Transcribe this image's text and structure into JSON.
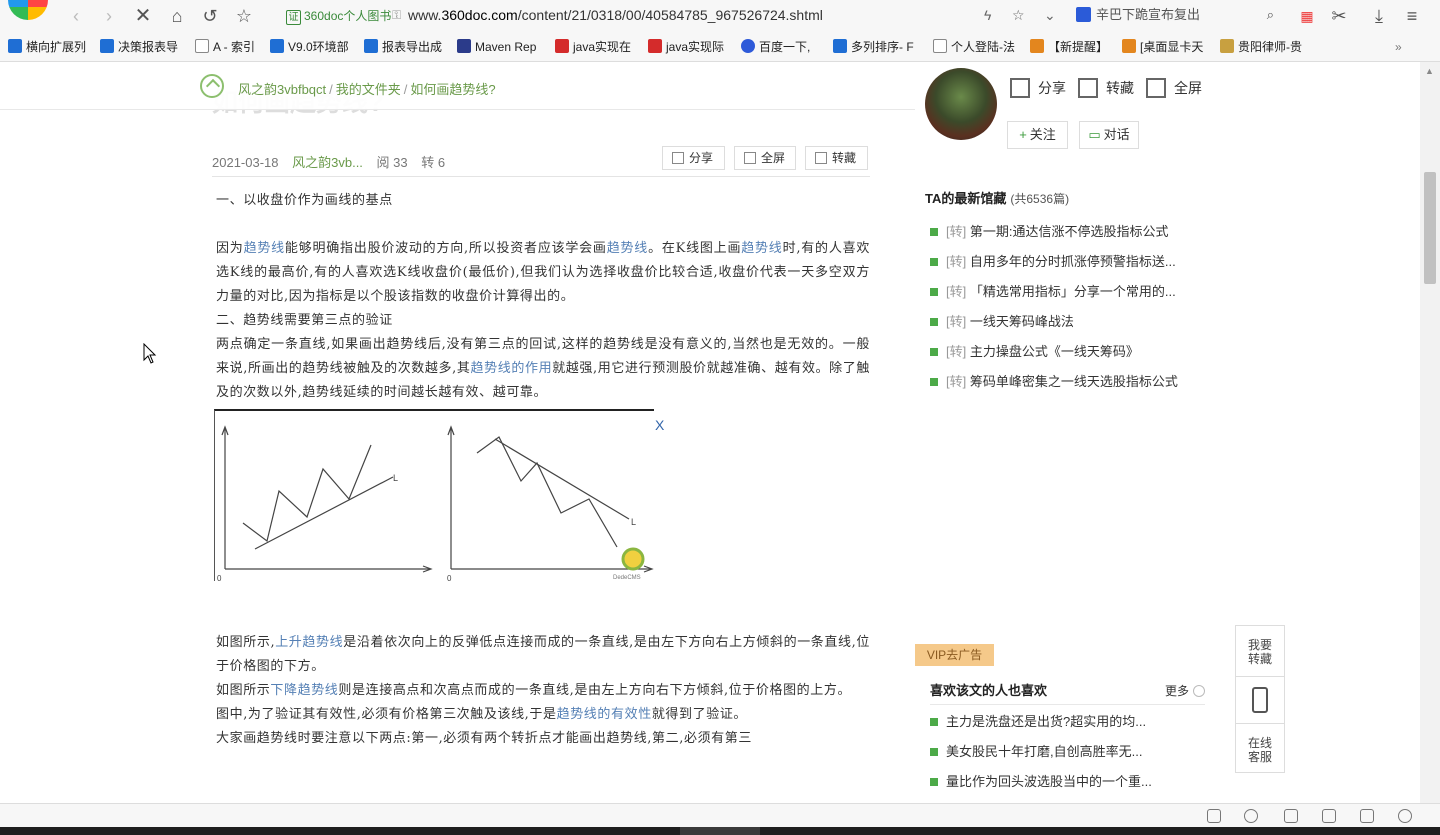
{
  "browser": {
    "site_tag": "360doc个人图书",
    "url_prefix": "www.",
    "url_domain": "360doc.com",
    "url_path": "/content/21/0318/00/40584785_967526724.shtml",
    "search_text": "辛巴下跪宣布复出"
  },
  "bookmarks": [
    {
      "label": "横向扩展列",
      "icon": "blue"
    },
    {
      "label": "决策报表导",
      "icon": "blue"
    },
    {
      "label": "A - 索引",
      "icon": "doc"
    },
    {
      "label": "V9.0环境部",
      "icon": "blue"
    },
    {
      "label": "报表导出成",
      "icon": "blue"
    },
    {
      "label": "Maven Rep",
      "icon": "maven"
    },
    {
      "label": "java实现在",
      "icon": "red"
    },
    {
      "label": "java实现际",
      "icon": "red"
    },
    {
      "label": "百度一下,",
      "icon": "paw"
    },
    {
      "label": "多列排序- F",
      "icon": "blue"
    },
    {
      "label": "个人登陆-法",
      "icon": "doc"
    },
    {
      "label": "【新提醒】",
      "icon": "orange"
    },
    {
      "label": "[桌面显卡天",
      "icon": "orange"
    },
    {
      "label": "贵阳律师-贵",
      "icon": "pen"
    }
  ],
  "bookmarks_more": "»",
  "crumb": {
    "ghost_title": "如何画趋势线?",
    "user": "风之韵3vbfbqct",
    "folder": "我的文件夹",
    "page": "如何画趋势线?",
    "sep": "/"
  },
  "meta": {
    "date": "2021-03-18",
    "author": "风之韵3vb...",
    "reads": "阅 33",
    "shares": "转 6"
  },
  "article_actions": {
    "share": "分享",
    "fullscreen": "全屏",
    "save": "转藏"
  },
  "content": {
    "p1": "一、以收盘价作为画线的基点",
    "p2a": "因为",
    "p2k1": "趋势线",
    "p2b": "能够明确指出股价波动的方向,所以投资者应该学会画",
    "p2k2": "趋势线",
    "p2c": "。在K线图上画",
    "p2k3": "趋势线",
    "p2d": "时,有的人喜欢选K线的最高价,有的人喜欢选K线收盘价(最低价),但我们认为选择收盘价比较合适,收盘价代表一天多空双方力量的对比,因为指标是以个股该指数的收盘价计算得出的。",
    "p3": "二、趋势线需要第三点的验证",
    "p4a": "两点确定一条直线,如果画出趋势线后,没有第三点的回试,这样的趋势线是没有意义的,当然也是无效的。一般来说,所画出的趋势线被触及的次数越多,其",
    "p4k": "趋势线的作用",
    "p4b": "就越强,用它进行预测股价就越准确、越有效。除了触及的次数以外,趋势线延续的时间越长越有效、越可靠。",
    "fig_close": "X",
    "fig_label_l1": "L",
    "fig_label_l2": "L",
    "fig_origin1": "0",
    "fig_origin2": "0",
    "fig_watermark": "DedeCMS",
    "p5a": "如图所示,",
    "p5k": "上升趋势线",
    "p5b": "是沿着依次向上的反弹低点连接而成的一条直线,是由左下方向右上方倾斜的一条直线,位于价格图的下方。",
    "p6a": "如图所示",
    "p6k": "下降趋势线",
    "p6b": "则是连接高点和次高点而成的一条直线,是由左上方向右下方倾斜,位于价格图的上方。",
    "p7a": "图中,为了验证其有效性,必须有价格第三次触及该线,于是",
    "p7k": "趋势线的有效性",
    "p7b": "就得到了验证。",
    "p8": "大家画趋势线时要注意以下两点:第一,必须有两个转折点才能画出趋势线,第二,必须有第三"
  },
  "sidebar": {
    "share": "分享",
    "save": "转藏",
    "fullscreen": "全屏",
    "follow": "关注",
    "talk": "对话",
    "latest_title": "TA的最新馆藏",
    "latest_count": "(共6536篇)",
    "latest_tag": "[转]",
    "latest": [
      "第一期:通达信涨不停选股指标公式",
      "自用多年的分时抓涨停预警指标送...",
      "「精选常用指标」分享一个常用的...",
      "一线天筹码峰战法",
      "主力操盘公式《一线天筹码》",
      "筹码单峰密集之一线天选股指标公式"
    ],
    "vip_ad": "VIP去广告",
    "like_title": "喜欢该文的人也喜欢",
    "like_more": "更多",
    "likes": [
      "主力是洗盘还是出货?超实用的均...",
      "美女股民十年打磨,自创高胜率无...",
      "量比作为回头波选股当中的一个重..."
    ]
  },
  "float": {
    "save_l1": "我要",
    "save_l2": "转藏",
    "service_l1": "在线",
    "service_l2": "客服"
  },
  "colors": {
    "accent_green": "#4caa48",
    "link_green": "#6a9a4a",
    "keyword_blue": "#5580b5"
  }
}
